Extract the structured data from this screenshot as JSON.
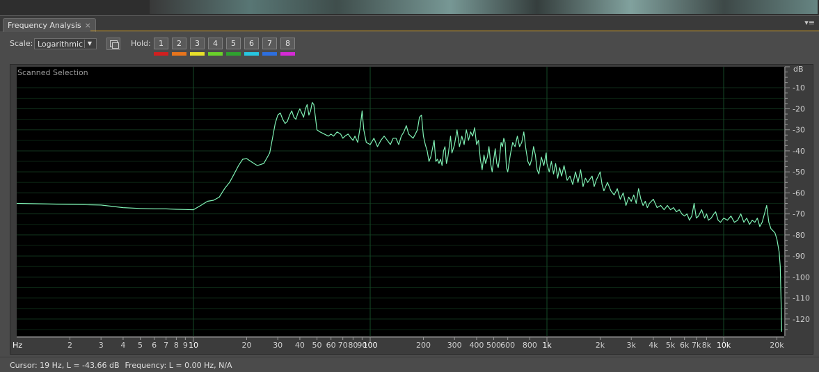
{
  "panel": {
    "title": "Frequency Analysis",
    "close_glyph": "×",
    "menu_glyph": "▾≡"
  },
  "toolbar": {
    "scale_label": "Scale:",
    "scale_value": "Logarithmic",
    "hold_label": "Hold:",
    "holds": [
      {
        "label": "1",
        "color": "#d11f1f"
      },
      {
        "label": "2",
        "color": "#e8741c"
      },
      {
        "label": "3",
        "color": "#e8e02a"
      },
      {
        "label": "4",
        "color": "#6ad12a"
      },
      {
        "label": "5",
        "color": "#2fa22f"
      },
      {
        "label": "6",
        "color": "#27c6e0"
      },
      {
        "label": "7",
        "color": "#2d6fe0"
      },
      {
        "label": "8",
        "color": "#d52ad6"
      }
    ]
  },
  "graph": {
    "label": "Scanned Selection",
    "y_unit": "dB",
    "x_unit": "Hz",
    "trace_color": "#7ff0b4"
  },
  "chart_data": {
    "type": "line",
    "xscale": "log",
    "xlim": [
      1,
      22000
    ],
    "ylim": [
      -128,
      0
    ],
    "x_ticks": [
      {
        "v": 2,
        "l": "2"
      },
      {
        "v": 3,
        "l": "3"
      },
      {
        "v": 4,
        "l": "4"
      },
      {
        "v": 5,
        "l": "5"
      },
      {
        "v": 6,
        "l": "6"
      },
      {
        "v": 7,
        "l": "7"
      },
      {
        "v": 8,
        "l": "8"
      },
      {
        "v": 9,
        "l": "9"
      },
      {
        "v": 10,
        "l": "10",
        "major": true
      },
      {
        "v": 20,
        "l": "20"
      },
      {
        "v": 30,
        "l": "30"
      },
      {
        "v": 40,
        "l": "40"
      },
      {
        "v": 50,
        "l": "50"
      },
      {
        "v": 60,
        "l": "60"
      },
      {
        "v": 70,
        "l": "70"
      },
      {
        "v": 80,
        "l": "80"
      },
      {
        "v": 90,
        "l": "90"
      },
      {
        "v": 100,
        "l": "100",
        "major": true
      },
      {
        "v": 200,
        "l": "200"
      },
      {
        "v": 300,
        "l": "300"
      },
      {
        "v": 400,
        "l": "400"
      },
      {
        "v": 500,
        "l": "500"
      },
      {
        "v": 600,
        "l": "600"
      },
      {
        "v": 800,
        "l": "800"
      },
      {
        "v": 1000,
        "l": "1k",
        "major": true
      },
      {
        "v": 2000,
        "l": "2k"
      },
      {
        "v": 3000,
        "l": "3k"
      },
      {
        "v": 4000,
        "l": "4k"
      },
      {
        "v": 5000,
        "l": "5k"
      },
      {
        "v": 6000,
        "l": "6k"
      },
      {
        "v": 7000,
        "l": "7k"
      },
      {
        "v": 8000,
        "l": "8k"
      },
      {
        "v": 10000,
        "l": "10k",
        "major": true
      },
      {
        "v": 20000,
        "l": "20k"
      }
    ],
    "y_ticks": [
      -10,
      -20,
      -30,
      -40,
      -50,
      -60,
      -70,
      -80,
      -90,
      -100,
      -110,
      -120
    ],
    "grid": true,
    "series": [
      {
        "points": [
          [
            1,
            -65
          ],
          [
            2,
            -65.5
          ],
          [
            3,
            -65.8
          ],
          [
            4,
            -67
          ],
          [
            5,
            -67.4
          ],
          [
            6,
            -67.6
          ],
          [
            7,
            -67.6
          ],
          [
            8,
            -67.8
          ],
          [
            9,
            -67.9
          ],
          [
            10,
            -68
          ],
          [
            11,
            -66
          ],
          [
            12,
            -64
          ],
          [
            13,
            -63.5
          ],
          [
            14,
            -62
          ],
          [
            15,
            -58
          ],
          [
            16,
            -55
          ],
          [
            17,
            -51
          ],
          [
            18,
            -47
          ],
          [
            19,
            -44
          ],
          [
            20,
            -43.7
          ],
          [
            22,
            -46
          ],
          [
            23,
            -47
          ],
          [
            25,
            -46
          ],
          [
            27,
            -41
          ],
          [
            28,
            -34
          ],
          [
            29,
            -27
          ],
          [
            30,
            -23
          ],
          [
            31,
            -22
          ],
          [
            32,
            -25
          ],
          [
            33,
            -27
          ],
          [
            34,
            -26
          ],
          [
            35,
            -23
          ],
          [
            36,
            -21
          ],
          [
            37,
            -24
          ],
          [
            38,
            -25
          ],
          [
            39,
            -22
          ],
          [
            40,
            -20
          ],
          [
            42,
            -24
          ],
          [
            43,
            -20
          ],
          [
            44,
            -18
          ],
          [
            45,
            -23
          ],
          [
            46,
            -21
          ],
          [
            47,
            -17
          ],
          [
            48,
            -18
          ],
          [
            49,
            -24
          ],
          [
            50,
            -30
          ],
          [
            52,
            -31
          ],
          [
            55,
            -32
          ],
          [
            58,
            -33
          ],
          [
            60,
            -32
          ],
          [
            62,
            -33
          ],
          [
            65,
            -31
          ],
          [
            68,
            -32
          ],
          [
            70,
            -34
          ],
          [
            72,
            -33
          ],
          [
            75,
            -32
          ],
          [
            78,
            -34
          ],
          [
            80,
            -35
          ],
          [
            82,
            -33
          ],
          [
            85,
            -36
          ],
          [
            88,
            -28
          ],
          [
            90,
            -21
          ],
          [
            92,
            -30
          ],
          [
            95,
            -36
          ],
          [
            100,
            -37
          ],
          [
            105,
            -34
          ],
          [
            110,
            -38
          ],
          [
            115,
            -35
          ],
          [
            120,
            -33
          ],
          [
            125,
            -35
          ],
          [
            130,
            -37
          ],
          [
            135,
            -34
          ],
          [
            140,
            -34
          ],
          [
            145,
            -37
          ],
          [
            150,
            -33
          ],
          [
            155,
            -31
          ],
          [
            160,
            -28
          ],
          [
            165,
            -32
          ],
          [
            170,
            -33
          ],
          [
            175,
            -34
          ],
          [
            180,
            -32
          ],
          [
            185,
            -30
          ],
          [
            190,
            -24
          ],
          [
            195,
            -23
          ],
          [
            200,
            -33
          ],
          [
            205,
            -37
          ],
          [
            210,
            -40
          ],
          [
            215,
            -45
          ],
          [
            220,
            -43
          ],
          [
            225,
            -39
          ],
          [
            230,
            -35
          ],
          [
            235,
            -45
          ],
          [
            240,
            -44
          ],
          [
            245,
            -46
          ],
          [
            250,
            -44
          ],
          [
            255,
            -47
          ],
          [
            260,
            -40
          ],
          [
            265,
            -38
          ],
          [
            270,
            -46
          ],
          [
            275,
            -43
          ],
          [
            280,
            -38
          ],
          [
            285,
            -33
          ],
          [
            290,
            -41
          ],
          [
            300,
            -37
          ],
          [
            310,
            -30
          ],
          [
            320,
            -38
          ],
          [
            330,
            -33
          ],
          [
            340,
            -37
          ],
          [
            350,
            -30
          ],
          [
            360,
            -35
          ],
          [
            370,
            -31
          ],
          [
            380,
            -33
          ],
          [
            390,
            -29
          ],
          [
            400,
            -37
          ],
          [
            410,
            -35
          ],
          [
            420,
            -44
          ],
          [
            430,
            -49
          ],
          [
            440,
            -42
          ],
          [
            450,
            -46
          ],
          [
            460,
            -43
          ],
          [
            470,
            -38
          ],
          [
            480,
            -46
          ],
          [
            490,
            -50
          ],
          [
            500,
            -44
          ],
          [
            510,
            -39
          ],
          [
            520,
            -46
          ],
          [
            530,
            -48
          ],
          [
            540,
            -43
          ],
          [
            550,
            -36
          ],
          [
            560,
            -38
          ],
          [
            570,
            -34
          ],
          [
            580,
            -36
          ],
          [
            590,
            -48
          ],
          [
            600,
            -50
          ],
          [
            620,
            -42
          ],
          [
            640,
            -36
          ],
          [
            660,
            -38
          ],
          [
            680,
            -33
          ],
          [
            700,
            -38
          ],
          [
            720,
            -36
          ],
          [
            740,
            -31
          ],
          [
            760,
            -39
          ],
          [
            780,
            -45
          ],
          [
            800,
            -47
          ],
          [
            820,
            -44
          ],
          [
            840,
            -38
          ],
          [
            860,
            -42
          ],
          [
            880,
            -49
          ],
          [
            900,
            -51
          ],
          [
            930,
            -43
          ],
          [
            960,
            -47
          ],
          [
            990,
            -41
          ],
          [
            1000,
            -46
          ],
          [
            1030,
            -50
          ],
          [
            1060,
            -45
          ],
          [
            1090,
            -51
          ],
          [
            1120,
            -46
          ],
          [
            1150,
            -53
          ],
          [
            1180,
            -48
          ],
          [
            1210,
            -52
          ],
          [
            1250,
            -47
          ],
          [
            1300,
            -54
          ],
          [
            1350,
            -52
          ],
          [
            1400,
            -56
          ],
          [
            1450,
            -50
          ],
          [
            1500,
            -55
          ],
          [
            1550,
            -49
          ],
          [
            1600,
            -57
          ],
          [
            1650,
            -53
          ],
          [
            1700,
            -55
          ],
          [
            1800,
            -52
          ],
          [
            1850,
            -57
          ],
          [
            1900,
            -54
          ],
          [
            1950,
            -52
          ],
          [
            2000,
            -50
          ],
          [
            2050,
            -56
          ],
          [
            2100,
            -59
          ],
          [
            2150,
            -57
          ],
          [
            2200,
            -55
          ],
          [
            2300,
            -59
          ],
          [
            2400,
            -61
          ],
          [
            2500,
            -58
          ],
          [
            2600,
            -63
          ],
          [
            2700,
            -60
          ],
          [
            2800,
            -66
          ],
          [
            2900,
            -62
          ],
          [
            3000,
            -64
          ],
          [
            3100,
            -61
          ],
          [
            3200,
            -65
          ],
          [
            3300,
            -58
          ],
          [
            3400,
            -63
          ],
          [
            3500,
            -66
          ],
          [
            3600,
            -64
          ],
          [
            3700,
            -67
          ],
          [
            3800,
            -65
          ],
          [
            4000,
            -63
          ],
          [
            4200,
            -67
          ],
          [
            4400,
            -66
          ],
          [
            4600,
            -68
          ],
          [
            4800,
            -66
          ],
          [
            5000,
            -68
          ],
          [
            5200,
            -67
          ],
          [
            5400,
            -69
          ],
          [
            5600,
            -68
          ],
          [
            5800,
            -70
          ],
          [
            6000,
            -71
          ],
          [
            6200,
            -70
          ],
          [
            6400,
            -73
          ],
          [
            6600,
            -71
          ],
          [
            6800,
            -65
          ],
          [
            7000,
            -72
          ],
          [
            7200,
            -71
          ],
          [
            7500,
            -68
          ],
          [
            7800,
            -72
          ],
          [
            8000,
            -70
          ],
          [
            8200,
            -73
          ],
          [
            8500,
            -72
          ],
          [
            8800,
            -70
          ],
          [
            9000,
            -69
          ],
          [
            9300,
            -73
          ],
          [
            9600,
            -74
          ],
          [
            10000,
            -72
          ],
          [
            10500,
            -73
          ],
          [
            11000,
            -71
          ],
          [
            11500,
            -74
          ],
          [
            12000,
            -73
          ],
          [
            12500,
            -70
          ],
          [
            13000,
            -74
          ],
          [
            13500,
            -72
          ],
          [
            14000,
            -75
          ],
          [
            14500,
            -73
          ],
          [
            15000,
            -74
          ],
          [
            15500,
            -72
          ],
          [
            16000,
            -76
          ],
          [
            16500,
            -74
          ],
          [
            17000,
            -70
          ],
          [
            17500,
            -66
          ],
          [
            18000,
            -74
          ],
          [
            18500,
            -77
          ],
          [
            19000,
            -78
          ],
          [
            19500,
            -79
          ],
          [
            20000,
            -82
          ],
          [
            20300,
            -85
          ],
          [
            20600,
            -88
          ],
          [
            20900,
            -95
          ],
          [
            21100,
            -110
          ],
          [
            21300,
            -126
          ]
        ]
      }
    ]
  },
  "status": {
    "cursor": "Cursor: 19 Hz, L = -43.66 dB",
    "frequency": "Frequency: L = 0.00 Hz, N/A"
  }
}
